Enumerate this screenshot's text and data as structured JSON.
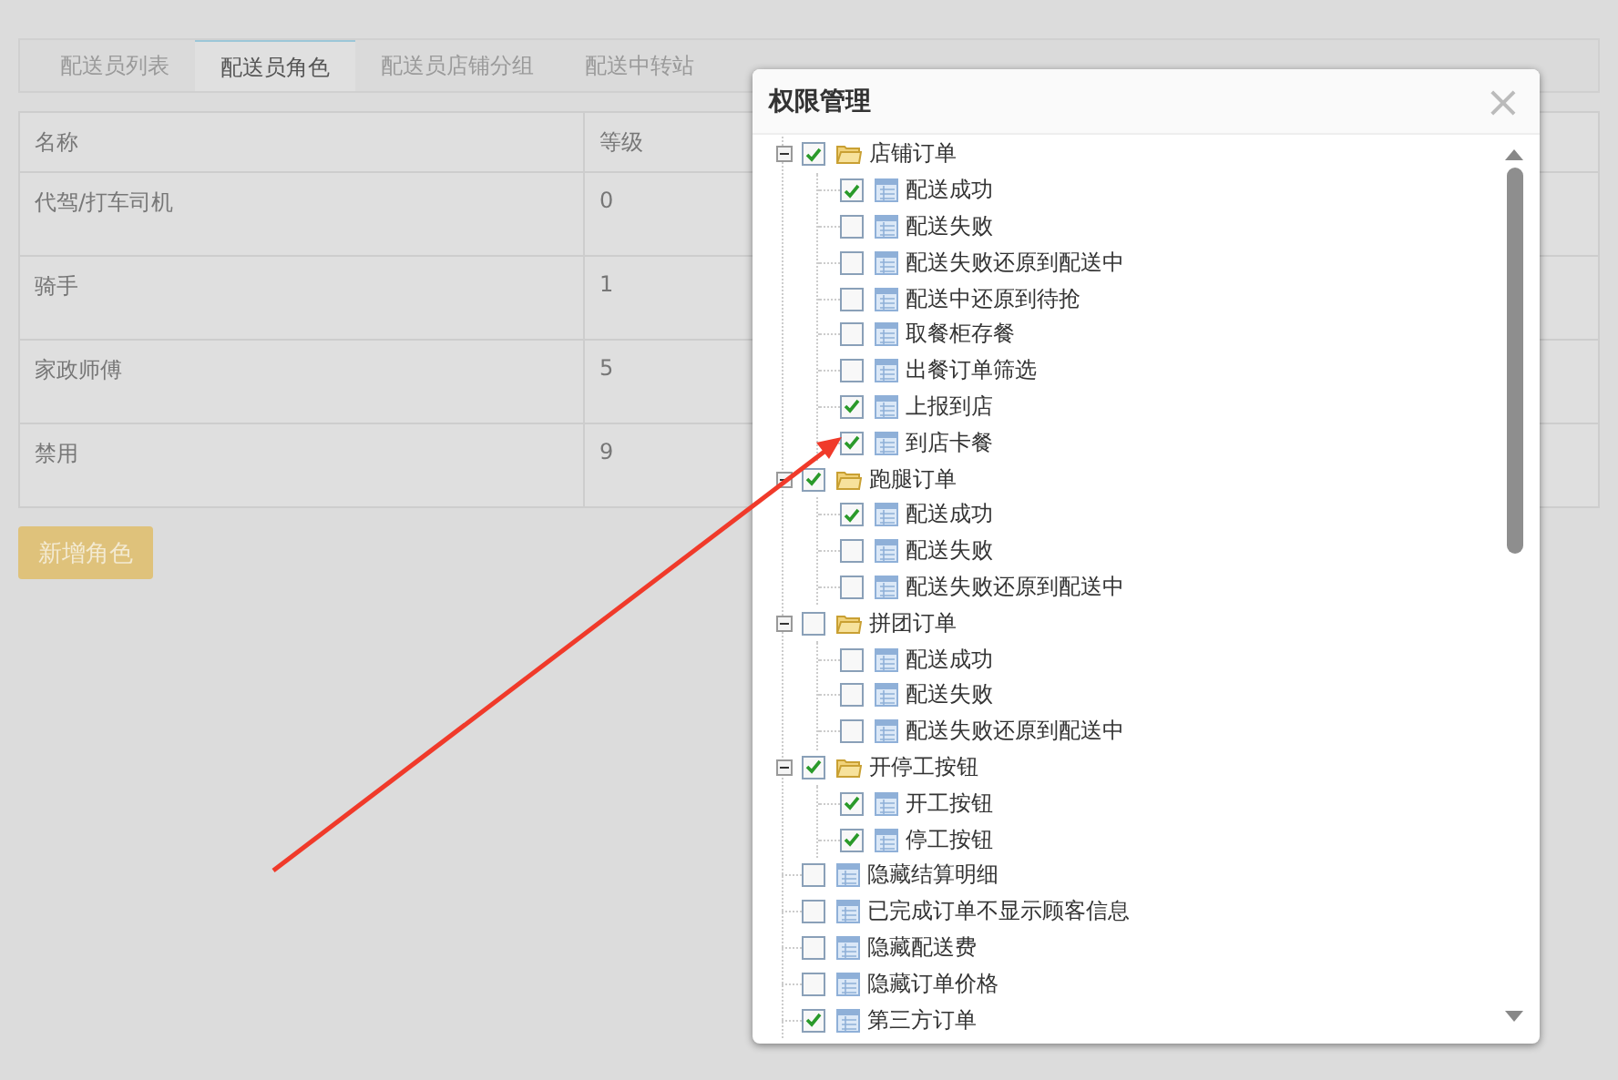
{
  "tabs": [
    {
      "label": "配送员列表",
      "selected": false
    },
    {
      "label": "配送员角色",
      "selected": true
    },
    {
      "label": "配送员店铺分组",
      "selected": false
    },
    {
      "label": "配送中转站",
      "selected": false
    }
  ],
  "table": {
    "columns": [
      "名称",
      "等级"
    ],
    "rows": [
      [
        "代驾/打车司机",
        "0"
      ],
      [
        "骑手",
        "1"
      ],
      [
        "家政师傅",
        "5"
      ],
      [
        "禁用",
        "9"
      ]
    ]
  },
  "add_button": "新增角色",
  "dialog": {
    "title": "权限管理",
    "close": "×",
    "tree": [
      {
        "label": "店铺订单",
        "checked": true,
        "expanded": true,
        "children": [
          {
            "label": "配送成功",
            "checked": true
          },
          {
            "label": "配送失败",
            "checked": false
          },
          {
            "label": "配送失败还原到配送中",
            "checked": false
          },
          {
            "label": "配送中还原到待抢",
            "checked": false
          },
          {
            "label": "取餐柜存餐",
            "checked": false
          },
          {
            "label": "出餐订单筛选",
            "checked": false
          },
          {
            "label": "上报到店",
            "checked": true
          },
          {
            "label": "到店卡餐",
            "checked": true
          }
        ]
      },
      {
        "label": "跑腿订单",
        "checked": true,
        "expanded": true,
        "children": [
          {
            "label": "配送成功",
            "checked": true
          },
          {
            "label": "配送失败",
            "checked": false
          },
          {
            "label": "配送失败还原到配送中",
            "checked": false
          }
        ]
      },
      {
        "label": "拼团订单",
        "checked": false,
        "expanded": true,
        "children": [
          {
            "label": "配送成功",
            "checked": false
          },
          {
            "label": "配送失败",
            "checked": false
          },
          {
            "label": "配送失败还原到配送中",
            "checked": false
          }
        ]
      },
      {
        "label": "开停工按钮",
        "checked": true,
        "expanded": true,
        "children": [
          {
            "label": "开工按钮",
            "checked": true
          },
          {
            "label": "停工按钮",
            "checked": true
          }
        ]
      },
      {
        "label": "隐藏结算明细",
        "checked": false
      },
      {
        "label": "已完成订单不显示顾客信息",
        "checked": false
      },
      {
        "label": "隐藏配送费",
        "checked": false
      },
      {
        "label": "隐藏订单价格",
        "checked": false
      },
      {
        "label": "第三方订单",
        "checked": true
      }
    ]
  }
}
